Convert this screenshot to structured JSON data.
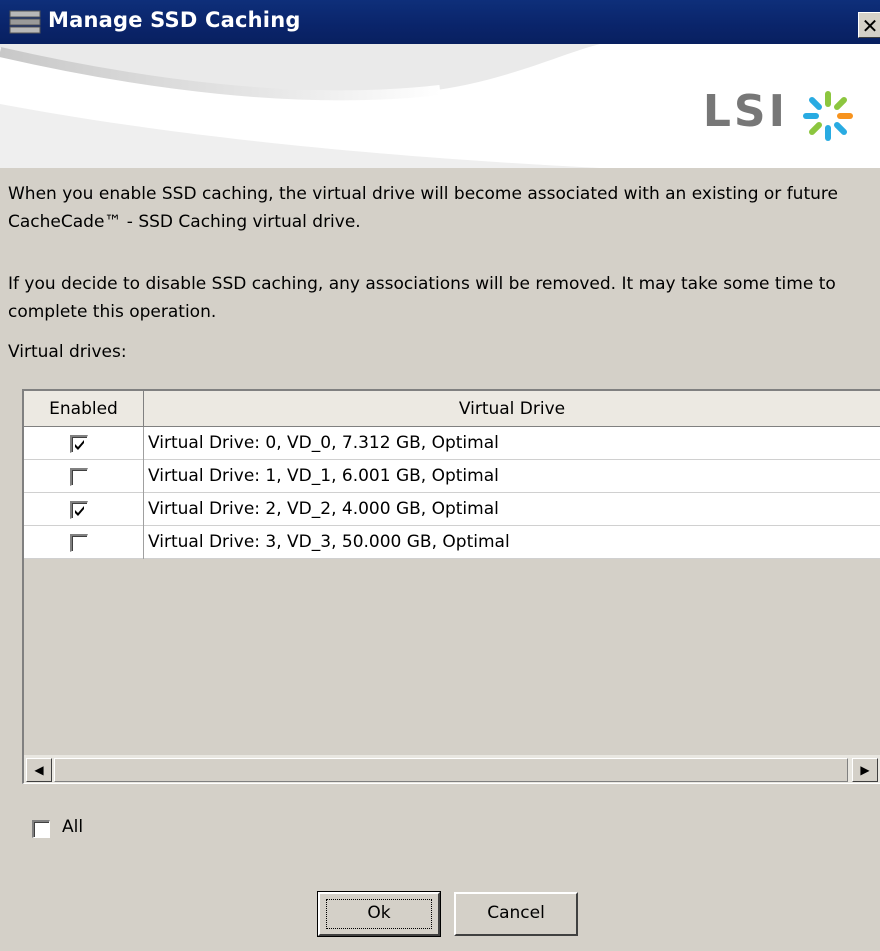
{
  "window": {
    "title": "Manage SSD Caching",
    "close_glyph": "✕"
  },
  "banner": {
    "logo_text": "LSI",
    "logo_icon": "lsi-starburst-icon"
  },
  "description": {
    "para1": "When you enable SSD caching, the virtual drive will become associated with an existing or future CacheCade™ - SSD Caching virtual drive.",
    "para2": "If you decide to disable SSD caching, any associations will be removed. It may take some time to complete this operation."
  },
  "table": {
    "label": "Virtual drives:",
    "columns": [
      "Enabled",
      "Virtual Drive"
    ],
    "rows": [
      {
        "enabled": true,
        "drive": "Virtual Drive: 0, VD_0, 7.312 GB, Optimal"
      },
      {
        "enabled": false,
        "drive": "Virtual Drive: 1, VD_1, 6.001 GB, Optimal"
      },
      {
        "enabled": true,
        "drive": "Virtual Drive: 2, VD_2, 4.000 GB, Optimal"
      },
      {
        "enabled": false,
        "drive": "Virtual Drive: 3, VD_3, 50.000 GB, Optimal"
      }
    ],
    "scroll_left_glyph": "◀",
    "scroll_right_glyph": "▶"
  },
  "all_checkbox": {
    "label": "All",
    "checked": false
  },
  "buttons": {
    "ok": "Ok",
    "cancel": "Cancel"
  }
}
